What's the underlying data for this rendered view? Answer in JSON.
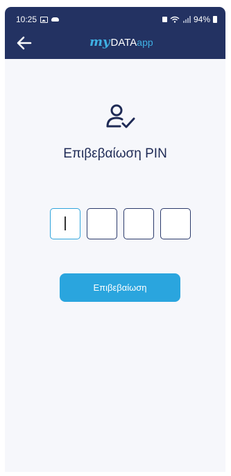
{
  "status_bar": {
    "time": "10:25",
    "battery": "94%"
  },
  "header": {
    "logo_my": "my",
    "logo_data": "DATA",
    "logo_app": "app"
  },
  "pin_screen": {
    "title": "Επιβεβαίωση PIN",
    "pin_digits": [
      "",
      "",
      "",
      ""
    ],
    "confirm_label": "Επιβεβαίωση"
  },
  "colors": {
    "header_bg": "#233262",
    "accent": "#2aa5de",
    "title_text": "#1e2a55"
  }
}
